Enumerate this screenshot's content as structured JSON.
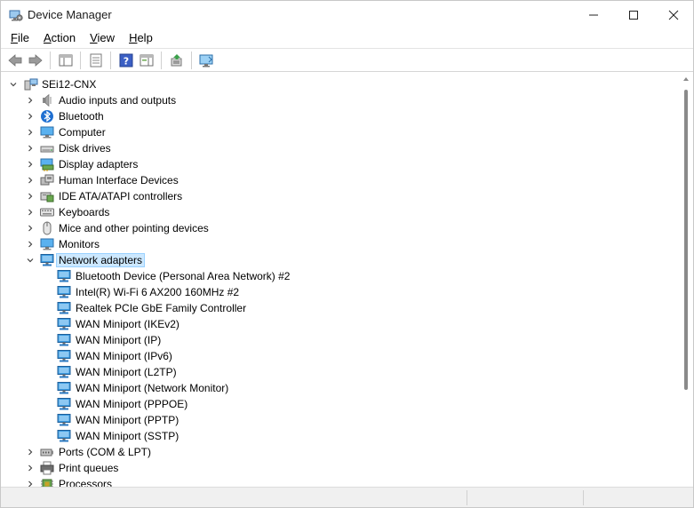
{
  "window": {
    "title": "Device Manager",
    "controls": {
      "minimize": "—",
      "maximize": "☐",
      "close": "✕"
    }
  },
  "menubar": {
    "items": [
      {
        "first": "F",
        "rest": "ile"
      },
      {
        "first": "A",
        "rest": "ction"
      },
      {
        "first": "V",
        "rest": "iew"
      },
      {
        "first": "H",
        "rest": "elp"
      }
    ]
  },
  "toolbar": {
    "buttons": [
      "back-icon",
      "forward-icon",
      "show-hide-console-tree-icon",
      "properties-icon",
      "help-icon",
      "action-pane-icon",
      "update-driver-icon",
      "scan-hardware-icon"
    ]
  },
  "tree": {
    "root": "SEi12-CNX",
    "categories": [
      {
        "label": "Audio inputs and outputs",
        "icon": "speaker-icon"
      },
      {
        "label": "Bluetooth",
        "icon": "bluetooth-icon"
      },
      {
        "label": "Computer",
        "icon": "computer-icon"
      },
      {
        "label": "Disk drives",
        "icon": "disk-drive-icon"
      },
      {
        "label": "Display adapters",
        "icon": "display-adapter-icon"
      },
      {
        "label": "Human Interface Devices",
        "icon": "hid-icon"
      },
      {
        "label": "IDE ATA/ATAPI controllers",
        "icon": "ide-controller-icon"
      },
      {
        "label": "Keyboards",
        "icon": "keyboard-icon"
      },
      {
        "label": "Mice and other pointing devices",
        "icon": "mouse-icon"
      },
      {
        "label": "Monitors",
        "icon": "monitor-icon"
      },
      {
        "label": "Network adapters",
        "icon": "network-adapter-icon",
        "expanded": true,
        "selected": true
      }
    ],
    "network_adapters": [
      "Bluetooth Device (Personal Area Network) #2",
      "Intel(R) Wi-Fi 6 AX200 160MHz #2",
      "Realtek PCIe GbE Family Controller",
      "WAN Miniport (IKEv2)",
      "WAN Miniport (IP)",
      "WAN Miniport (IPv6)",
      "WAN Miniport (L2TP)",
      "WAN Miniport (Network Monitor)",
      "WAN Miniport (PPPOE)",
      "WAN Miniport (PPTP)",
      "WAN Miniport (SSTP)"
    ],
    "more_categories": [
      {
        "label": "Ports (COM & LPT)",
        "icon": "port-icon"
      },
      {
        "label": "Print queues",
        "icon": "printer-icon"
      },
      {
        "label": "Processors",
        "icon": "processor-icon"
      }
    ]
  },
  "colors": {
    "selection": "#cce8ff",
    "selection_border": "#99d1ff",
    "network_icon": "#2a8bd8"
  }
}
